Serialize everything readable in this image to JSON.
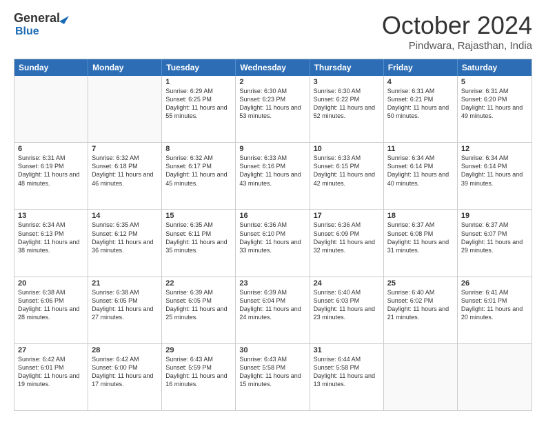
{
  "logo": {
    "general": "General",
    "blue": "Blue"
  },
  "title": "October 2024",
  "location": "Pindwara, Rajasthan, India",
  "days": [
    "Sunday",
    "Monday",
    "Tuesday",
    "Wednesday",
    "Thursday",
    "Friday",
    "Saturday"
  ],
  "weeks": [
    [
      {
        "day": "",
        "content": ""
      },
      {
        "day": "",
        "content": ""
      },
      {
        "day": "1",
        "content": "Sunrise: 6:29 AM\nSunset: 6:25 PM\nDaylight: 11 hours and 55 minutes."
      },
      {
        "day": "2",
        "content": "Sunrise: 6:30 AM\nSunset: 6:23 PM\nDaylight: 11 hours and 53 minutes."
      },
      {
        "day": "3",
        "content": "Sunrise: 6:30 AM\nSunset: 6:22 PM\nDaylight: 11 hours and 52 minutes."
      },
      {
        "day": "4",
        "content": "Sunrise: 6:31 AM\nSunset: 6:21 PM\nDaylight: 11 hours and 50 minutes."
      },
      {
        "day": "5",
        "content": "Sunrise: 6:31 AM\nSunset: 6:20 PM\nDaylight: 11 hours and 49 minutes."
      }
    ],
    [
      {
        "day": "6",
        "content": "Sunrise: 6:31 AM\nSunset: 6:19 PM\nDaylight: 11 hours and 48 minutes."
      },
      {
        "day": "7",
        "content": "Sunrise: 6:32 AM\nSunset: 6:18 PM\nDaylight: 11 hours and 46 minutes."
      },
      {
        "day": "8",
        "content": "Sunrise: 6:32 AM\nSunset: 6:17 PM\nDaylight: 11 hours and 45 minutes."
      },
      {
        "day": "9",
        "content": "Sunrise: 6:33 AM\nSunset: 6:16 PM\nDaylight: 11 hours and 43 minutes."
      },
      {
        "day": "10",
        "content": "Sunrise: 6:33 AM\nSunset: 6:15 PM\nDaylight: 11 hours and 42 minutes."
      },
      {
        "day": "11",
        "content": "Sunrise: 6:34 AM\nSunset: 6:14 PM\nDaylight: 11 hours and 40 minutes."
      },
      {
        "day": "12",
        "content": "Sunrise: 6:34 AM\nSunset: 6:14 PM\nDaylight: 11 hours and 39 minutes."
      }
    ],
    [
      {
        "day": "13",
        "content": "Sunrise: 6:34 AM\nSunset: 6:13 PM\nDaylight: 11 hours and 38 minutes."
      },
      {
        "day": "14",
        "content": "Sunrise: 6:35 AM\nSunset: 6:12 PM\nDaylight: 11 hours and 36 minutes."
      },
      {
        "day": "15",
        "content": "Sunrise: 6:35 AM\nSunset: 6:11 PM\nDaylight: 11 hours and 35 minutes."
      },
      {
        "day": "16",
        "content": "Sunrise: 6:36 AM\nSunset: 6:10 PM\nDaylight: 11 hours and 33 minutes."
      },
      {
        "day": "17",
        "content": "Sunrise: 6:36 AM\nSunset: 6:09 PM\nDaylight: 11 hours and 32 minutes."
      },
      {
        "day": "18",
        "content": "Sunrise: 6:37 AM\nSunset: 6:08 PM\nDaylight: 11 hours and 31 minutes."
      },
      {
        "day": "19",
        "content": "Sunrise: 6:37 AM\nSunset: 6:07 PM\nDaylight: 11 hours and 29 minutes."
      }
    ],
    [
      {
        "day": "20",
        "content": "Sunrise: 6:38 AM\nSunset: 6:06 PM\nDaylight: 11 hours and 28 minutes."
      },
      {
        "day": "21",
        "content": "Sunrise: 6:38 AM\nSunset: 6:05 PM\nDaylight: 11 hours and 27 minutes."
      },
      {
        "day": "22",
        "content": "Sunrise: 6:39 AM\nSunset: 6:05 PM\nDaylight: 11 hours and 25 minutes."
      },
      {
        "day": "23",
        "content": "Sunrise: 6:39 AM\nSunset: 6:04 PM\nDaylight: 11 hours and 24 minutes."
      },
      {
        "day": "24",
        "content": "Sunrise: 6:40 AM\nSunset: 6:03 PM\nDaylight: 11 hours and 23 minutes."
      },
      {
        "day": "25",
        "content": "Sunrise: 6:40 AM\nSunset: 6:02 PM\nDaylight: 11 hours and 21 minutes."
      },
      {
        "day": "26",
        "content": "Sunrise: 6:41 AM\nSunset: 6:01 PM\nDaylight: 11 hours and 20 minutes."
      }
    ],
    [
      {
        "day": "27",
        "content": "Sunrise: 6:42 AM\nSunset: 6:01 PM\nDaylight: 11 hours and 19 minutes."
      },
      {
        "day": "28",
        "content": "Sunrise: 6:42 AM\nSunset: 6:00 PM\nDaylight: 11 hours and 17 minutes."
      },
      {
        "day": "29",
        "content": "Sunrise: 6:43 AM\nSunset: 5:59 PM\nDaylight: 11 hours and 16 minutes."
      },
      {
        "day": "30",
        "content": "Sunrise: 6:43 AM\nSunset: 5:58 PM\nDaylight: 11 hours and 15 minutes."
      },
      {
        "day": "31",
        "content": "Sunrise: 6:44 AM\nSunset: 5:58 PM\nDaylight: 11 hours and 13 minutes."
      },
      {
        "day": "",
        "content": ""
      },
      {
        "day": "",
        "content": ""
      }
    ]
  ]
}
